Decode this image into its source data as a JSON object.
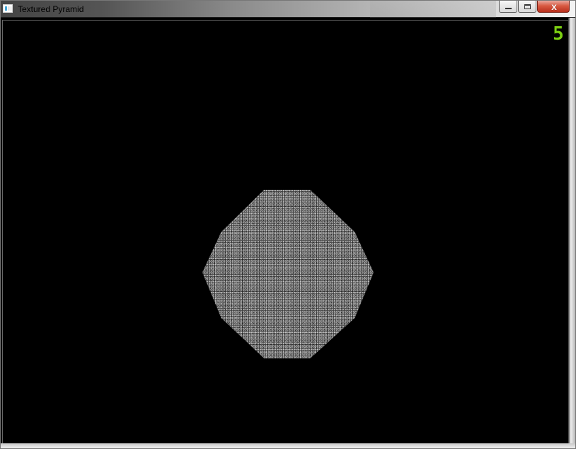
{
  "window": {
    "title": "Textured Pyramid",
    "controls": {
      "minimize": "minimize-icon",
      "maximize": "maximize-icon",
      "close": "close-icon"
    }
  },
  "scene": {
    "counter_value": "5",
    "background_color": "#000000",
    "counter_color": "#7ccf12",
    "object": "textured-pyramid",
    "texture_color": "#555555"
  }
}
